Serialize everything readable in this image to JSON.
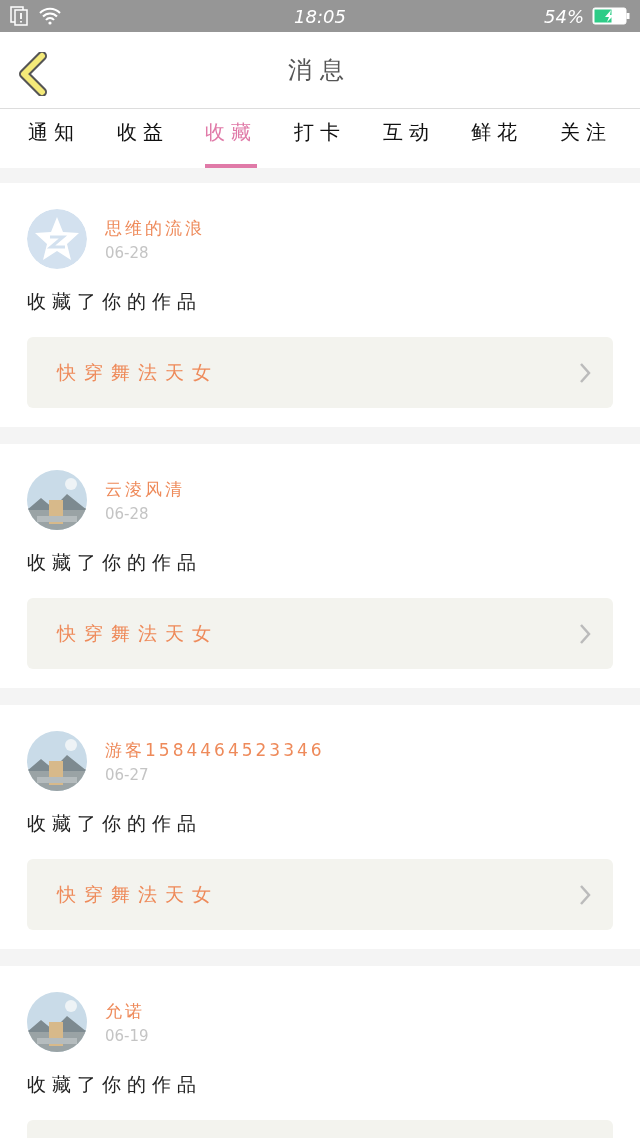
{
  "status_bar": {
    "time": "18:05",
    "battery": "54%"
  },
  "header": {
    "title": "消息"
  },
  "tabs": [
    {
      "label": "通知",
      "selected": false
    },
    {
      "label": "收益",
      "selected": false
    },
    {
      "label": "收藏",
      "selected": true
    },
    {
      "label": "打卡",
      "selected": false
    },
    {
      "label": "互动",
      "selected": false
    },
    {
      "label": "鲜花",
      "selected": false
    },
    {
      "label": "关注",
      "selected": false
    }
  ],
  "messages": [
    {
      "avatar": {
        "kind": "default"
      },
      "name": "思维的流浪",
      "date": "06-28",
      "text": "收藏了你的作品",
      "work": "快穿舞法天女"
    },
    {
      "name": "云淩风清",
      "date": "06-28",
      "text": "收藏了你的作品",
      "work": "快穿舞法天女"
    },
    {
      "name": "游客1584464523346",
      "date": "06-27",
      "text": "收藏了你的作品",
      "work": "快穿舞法天女"
    },
    {
      "name": "允诺",
      "date": "06-19",
      "text": "收藏了你的作品"
    }
  ]
}
